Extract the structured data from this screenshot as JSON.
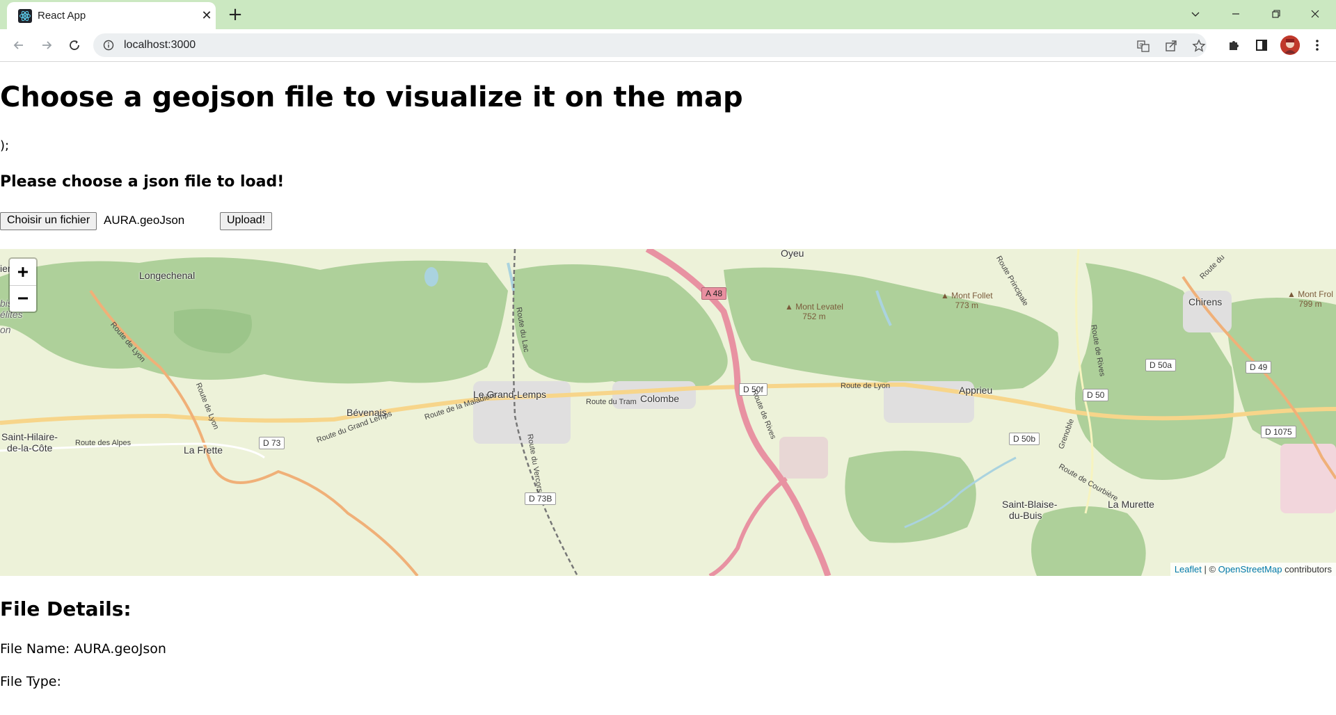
{
  "browser": {
    "tab_title": "React App",
    "url": "localhost:3000",
    "icons": {
      "tab_favicon": "react-icon",
      "tab_close": "close-icon",
      "new_tab": "plus-icon",
      "back": "arrow-left-icon",
      "forward": "arrow-right-icon",
      "reload": "reload-icon",
      "site_info": "info-icon",
      "translate": "translate-icon",
      "share": "share-icon",
      "bookmark": "star-icon",
      "extensions": "puzzle-icon",
      "side_panel": "side-panel-icon",
      "menu": "kebab-menu-icon"
    }
  },
  "page": {
    "title": "Choose a geojson file to visualize it on the map",
    "stray_text": ");",
    "prompt": "Please choose a json file to load!",
    "file_button_label": "Choisir un fichier",
    "selected_file": "AURA.geoJson",
    "upload_label": "Upload!"
  },
  "map": {
    "zoom_in": "+",
    "zoom_out": "−",
    "attribution": {
      "leaflet": "Leaflet",
      "separator": " | © ",
      "osm": "OpenStreetMap",
      "suffix": " contributors"
    },
    "places": [
      "Oyeu",
      "Longechenal",
      "Chirens",
      "Le Grand-Lemps",
      "Colombe",
      "Apprieu",
      "Bévenais",
      "La Frette",
      "Saint-Hilaire-",
      "de-la-Côte",
      "Saint-Blaise-",
      "du-Buis",
      "La Murette",
      "ier",
      "bis des",
      "élites",
      "on"
    ],
    "peaks": [
      {
        "name": "Mont Levatel",
        "elevation": "752 m"
      },
      {
        "name": "Mont Follet",
        "elevation": "773 m"
      },
      {
        "name": "Mont Frol",
        "elevation": "799 m"
      }
    ],
    "shields": [
      "A 48",
      "D 50f",
      "D 50a",
      "D 49",
      "D 50",
      "D 50b",
      "D 1075",
      "D 73",
      "D 73B"
    ],
    "roads": [
      "Route de Lyon",
      "Route de Lyon",
      "Route de Lyon",
      "Route du Grand Lemps",
      "Route de la Maladière",
      "Route du Tram",
      "Route des Alpes",
      "Route de Rives",
      "Route de Rives",
      "Route du Lac",
      "Route du Vercors",
      "Route de Courbière",
      "Route Principale",
      "Grenoble",
      "Route du"
    ],
    "colors": {
      "forest": "#aed09a",
      "land": "#edf2d9",
      "motorway": "#e892a2",
      "road": "#f7d58a",
      "water": "#aad3df"
    }
  },
  "details": {
    "heading": "File Details:",
    "file_name": "File Name: AURA.geoJson",
    "file_type": "File Type:"
  }
}
